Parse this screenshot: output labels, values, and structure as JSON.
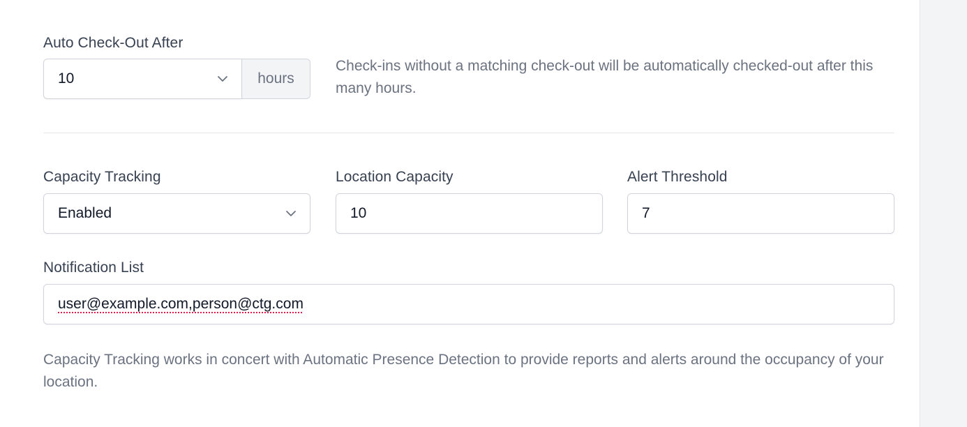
{
  "auto_checkout": {
    "label": "Auto Check-Out After",
    "selected_value": "10",
    "unit": "hours",
    "help_text": "Check-ins without a matching check-out will be automatically checked-out after this many hours."
  },
  "capacity_tracking": {
    "label": "Capacity Tracking",
    "selected_value": "Enabled"
  },
  "location_capacity": {
    "label": "Location Capacity",
    "value": "10"
  },
  "alert_threshold": {
    "label": "Alert Threshold",
    "value": "7"
  },
  "notification_list": {
    "label": "Notification List",
    "value": "user@example.com,person@ctg.com"
  },
  "footer_help": "Capacity Tracking works in concert with Automatic Presence Detection to provide reports and alerts around the occupancy of your location.",
  "colors": {
    "label_text": "#374151",
    "help_text": "#6b7280",
    "border": "#d1d5db",
    "addon_bg": "#f3f4f6",
    "side_panel_bg": "#f3f4f6"
  },
  "icons": {
    "select_chevron": "chevron-down-icon"
  }
}
